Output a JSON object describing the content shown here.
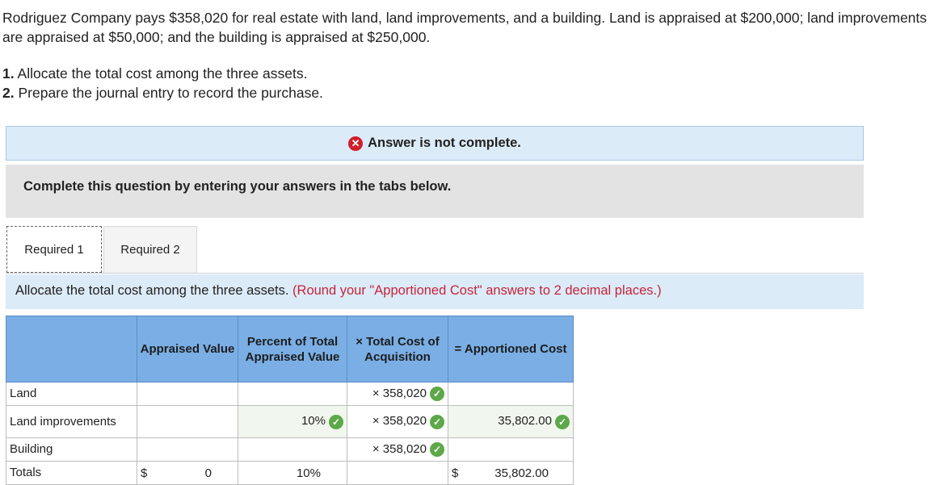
{
  "question": {
    "text": "Rodriguez Company pays $358,020 for real estate with land, land improvements, and a building. Land is appraised at $200,000; land improvements are appraised at $50,000; and the building is appraised at $250,000.",
    "items": [
      {
        "num": "1.",
        "text": "Allocate the total cost among the three assets."
      },
      {
        "num": "2.",
        "text": "Prepare the journal entry to record the purchase."
      }
    ]
  },
  "banner_incomplete": "Answer is not complete.",
  "banner_instruction": "Complete this question by entering your answers in the tabs below.",
  "tabs": [
    {
      "label": "Required 1",
      "active": true
    },
    {
      "label": "Required 2",
      "active": false
    }
  ],
  "instruction": {
    "main": "Allocate the total cost among the three assets.",
    "note": "(Round your \"Apportioned Cost\" answers to 2 decimal places.)"
  },
  "table": {
    "headers": [
      "",
      "Appraised Value",
      "Percent of Total Appraised Value",
      "× Total Cost of Acquisition",
      "= Apportioned Cost"
    ],
    "rows": [
      {
        "label": "Land",
        "appraised": "",
        "percent": "",
        "total_cost": "× 358,020",
        "apportioned": ""
      },
      {
        "label": "Land improvements",
        "appraised": "",
        "percent": "10%",
        "total_cost": "× 358,020",
        "apportioned": "35,802.00"
      },
      {
        "label": "Building",
        "appraised": "",
        "percent": "",
        "total_cost": "× 358,020",
        "apportioned": ""
      }
    ],
    "totals": {
      "label": "Totals",
      "currency": "$",
      "appraised": "0",
      "percent": "10%",
      "apportioned": "35,802.00"
    }
  },
  "colors": {
    "header_bg": "#7aaee5",
    "check": "#5da84a",
    "error": "#d11f2a",
    "note": "#c7243a"
  }
}
